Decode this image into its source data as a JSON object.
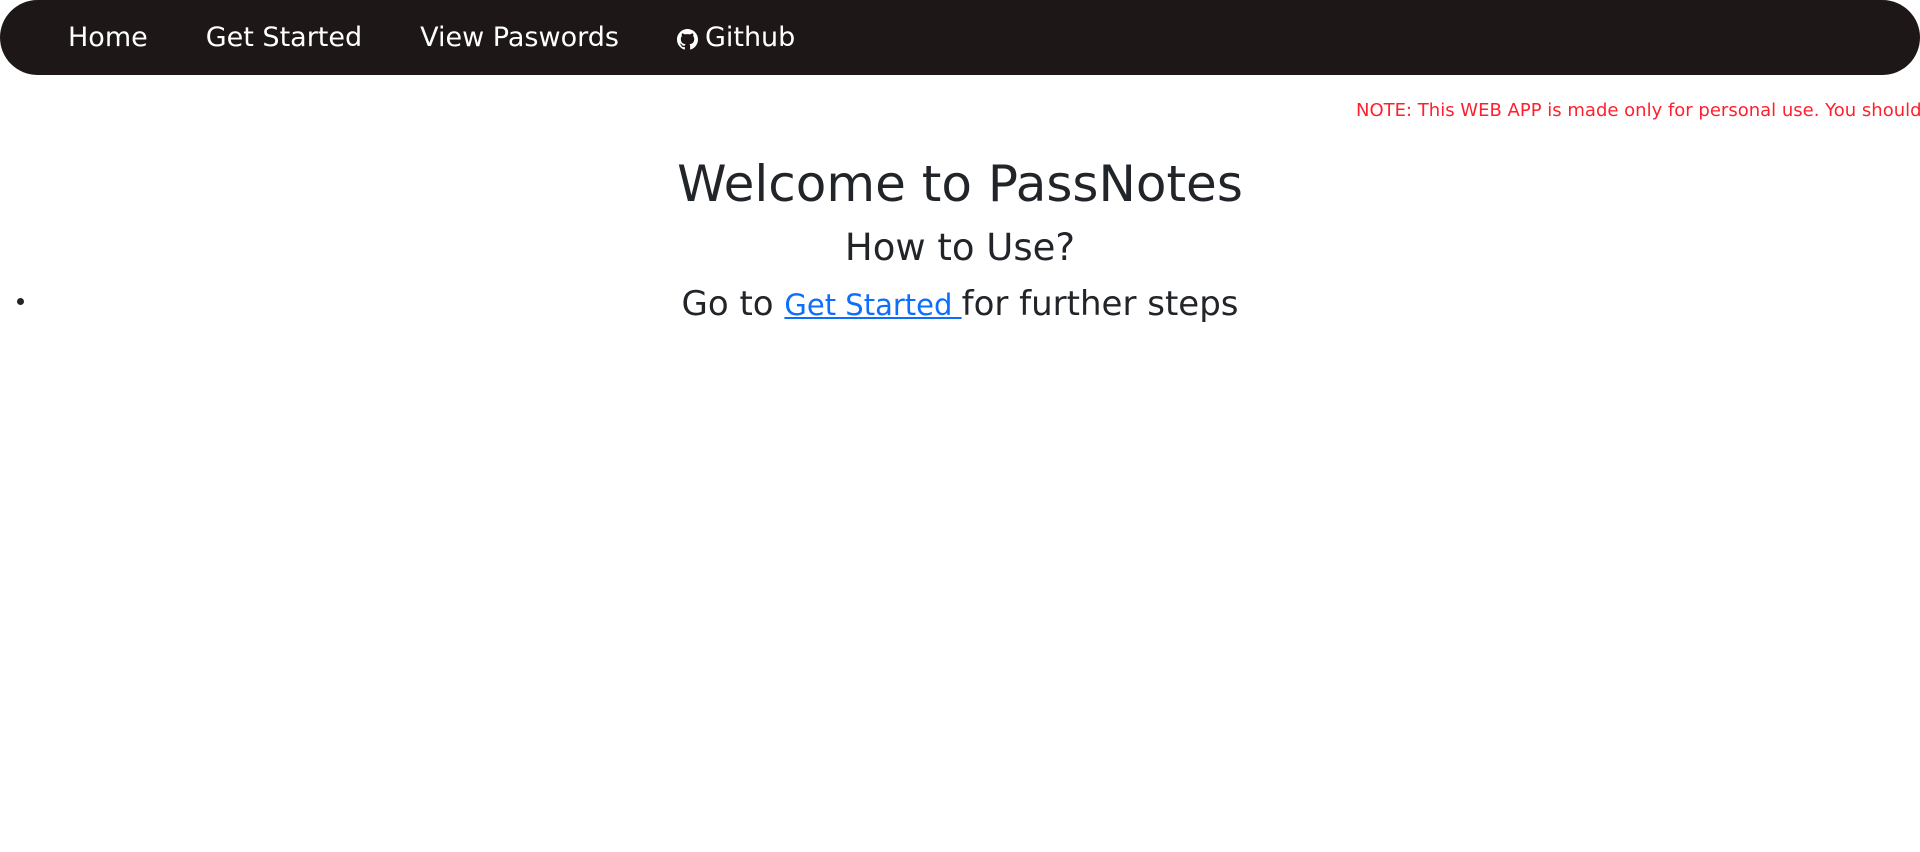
{
  "nav": {
    "items": [
      {
        "label": "Home"
      },
      {
        "label": "Get Started"
      },
      {
        "label": "View Paswords"
      },
      {
        "label": "Github",
        "icon": "github-icon"
      }
    ]
  },
  "note": {
    "text": "NOTE: This WEB APP is made only for personal use. You should n",
    "color": "#ff1f2e"
  },
  "main": {
    "title": "Welcome to PassNotes",
    "subtitle": "How to Use?",
    "steps": [
      {
        "prefix": "Go to ",
        "link": "Get Started ",
        "suffix": "for further steps"
      }
    ]
  },
  "colors": {
    "navbar_bg": "#1d1717",
    "link": "#0d6efd",
    "text": "#212529"
  }
}
